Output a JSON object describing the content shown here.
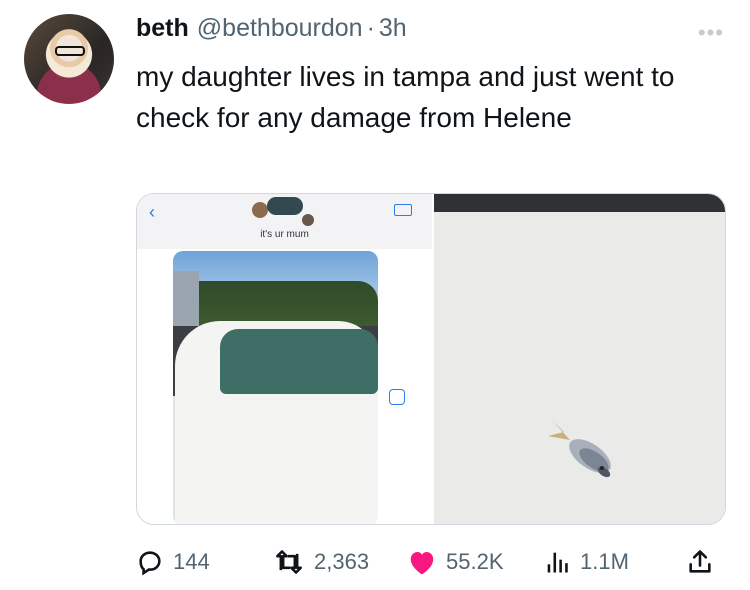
{
  "post": {
    "author_name": "beth",
    "author_handle": "@bethbourdon",
    "separator": "·",
    "time": "3h",
    "more_label": "•••",
    "text": "my daughter lives in tampa and just went to check for any damage from Helene"
  },
  "media": {
    "left": {
      "chat_contact_label": "it's ur mum"
    }
  },
  "actions": {
    "replies": "144",
    "reposts": "2,363",
    "likes": "55.2K",
    "views": "1.1M"
  },
  "colors": {
    "text": "#0f1419",
    "muted": "#536471",
    "like": "#f91880",
    "border": "#cfd9de",
    "ios_blue": "#2b7de9"
  },
  "icons": [
    "reply-icon",
    "repost-icon",
    "like-icon",
    "views-icon",
    "share-icon",
    "more-icon"
  ]
}
